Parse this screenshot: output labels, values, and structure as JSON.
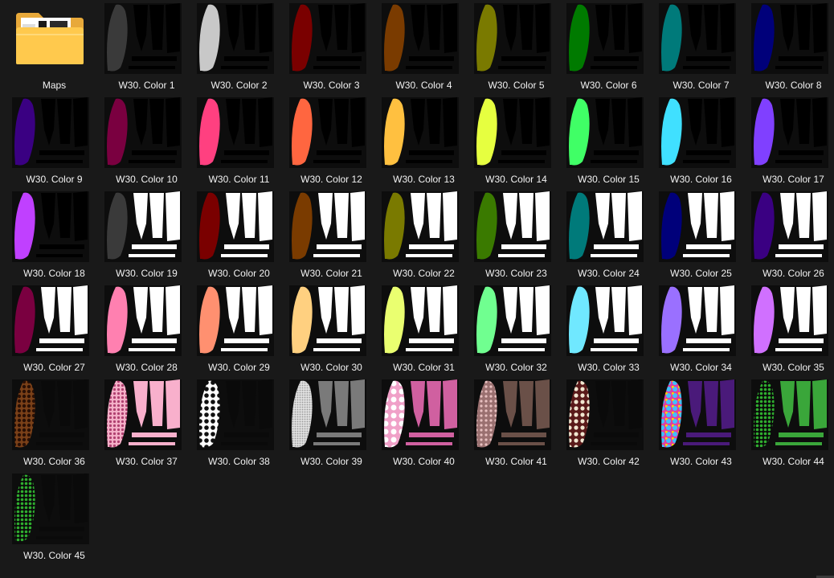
{
  "folder": {
    "label": "Maps",
    "icon": "folder-icon"
  },
  "items": [
    {
      "label": "W30. Color 1",
      "style": "dark",
      "color": "#3a3a3a"
    },
    {
      "label": "W30. Color 2",
      "style": "dark",
      "color": "#c8c8c8"
    },
    {
      "label": "W30. Color 3",
      "style": "dark",
      "color": "#7a0000"
    },
    {
      "label": "W30. Color 4",
      "style": "dark",
      "color": "#7a3b00"
    },
    {
      "label": "W30. Color 5",
      "style": "dark",
      "color": "#7a7a00"
    },
    {
      "label": "W30. Color 6",
      "style": "dark",
      "color": "#007a00"
    },
    {
      "label": "W30. Color 7",
      "style": "dark",
      "color": "#007a7a"
    },
    {
      "label": "W30. Color 8",
      "style": "dark",
      "color": "#00007a"
    },
    {
      "label": "W30. Color 9",
      "style": "dark",
      "color": "#3a0082"
    },
    {
      "label": "W30. Color 10",
      "style": "dark",
      "color": "#7a0040"
    },
    {
      "label": "W30. Color 11",
      "style": "dark",
      "color": "#ff4080"
    },
    {
      "label": "W30. Color 12",
      "style": "dark",
      "color": "#ff6640"
    },
    {
      "label": "W30. Color 13",
      "style": "dark",
      "color": "#ffc040"
    },
    {
      "label": "W30. Color 14",
      "style": "dark",
      "color": "#e6ff40"
    },
    {
      "label": "W30. Color 15",
      "style": "dark",
      "color": "#40ff66"
    },
    {
      "label": "W30. Color 16",
      "style": "dark",
      "color": "#40e0ff"
    },
    {
      "label": "W30. Color 17",
      "style": "dark",
      "color": "#8040ff"
    },
    {
      "label": "W30. Color 18",
      "style": "dark",
      "color": "#c040ff"
    },
    {
      "label": "W30. Color 19",
      "style": "white",
      "color": "#3a3a3a"
    },
    {
      "label": "W30. Color 20",
      "style": "white",
      "color": "#7a0000"
    },
    {
      "label": "W30. Color 21",
      "style": "white",
      "color": "#7a3b00"
    },
    {
      "label": "W30. Color 22",
      "style": "white",
      "color": "#7a7a00"
    },
    {
      "label": "W30. Color 23",
      "style": "white",
      "color": "#3a7a00"
    },
    {
      "label": "W30. Color 24",
      "style": "white",
      "color": "#007a7a"
    },
    {
      "label": "W30. Color 25",
      "style": "white",
      "color": "#00007a"
    },
    {
      "label": "W30. Color 26",
      "style": "white",
      "color": "#3a0082"
    },
    {
      "label": "W30. Color 27",
      "style": "white",
      "color": "#7a0040"
    },
    {
      "label": "W30. Color 28",
      "style": "white",
      "color": "#ff80b0"
    },
    {
      "label": "W30. Color 29",
      "style": "white",
      "color": "#ff9070"
    },
    {
      "label": "W30. Color 30",
      "style": "white",
      "color": "#ffd080"
    },
    {
      "label": "W30. Color 31",
      "style": "white",
      "color": "#eaff70"
    },
    {
      "label": "W30. Color 32",
      "style": "white",
      "color": "#70ff90"
    },
    {
      "label": "W30. Color 33",
      "style": "white",
      "color": "#70e8ff"
    },
    {
      "label": "W30. Color 34",
      "style": "white",
      "color": "#9a70ff"
    },
    {
      "label": "W30. Color 35",
      "style": "white",
      "color": "#d070ff"
    },
    {
      "label": "W30. Color 36",
      "style": "pattern",
      "color": "#7a4018",
      "right": "#0a0a0a",
      "pattern": "leopard"
    },
    {
      "label": "W30. Color 37",
      "style": "pattern",
      "color": "#f4b0c8",
      "right": "#f8b0cc",
      "pattern": "pink-leopard"
    },
    {
      "label": "W30. Color 38",
      "style": "pattern",
      "color": "#ffffff",
      "right": "#0a0a0a",
      "pattern": "cow"
    },
    {
      "label": "W30. Color 39",
      "style": "pattern",
      "color": "#d8d8d8",
      "right": "#7a7a7a",
      "pattern": "dots"
    },
    {
      "label": "W30. Color 40",
      "style": "pattern",
      "color": "#e890c0",
      "right": "#d060a0",
      "pattern": "tie-dye"
    },
    {
      "label": "W30. Color 41",
      "style": "pattern",
      "color": "#9a7070",
      "right": "#6a5048",
      "pattern": "floral"
    },
    {
      "label": "W30. Color 42",
      "style": "pattern",
      "color": "#6a2020",
      "right": "#0a0a0a",
      "pattern": "skulls"
    },
    {
      "label": "W30. Color 43",
      "style": "pattern",
      "color": "#e040a0",
      "right": "#4a1a7a",
      "pattern": "rainbow"
    },
    {
      "label": "W30. Color 44",
      "style": "pattern",
      "color": "#1a5a1a",
      "right": "#3aa63a",
      "pattern": "clover"
    },
    {
      "label": "W30. Color 45",
      "style": "pattern",
      "color": "#1a5a1a",
      "right": "#0a0a0a",
      "pattern": "clover"
    }
  ]
}
